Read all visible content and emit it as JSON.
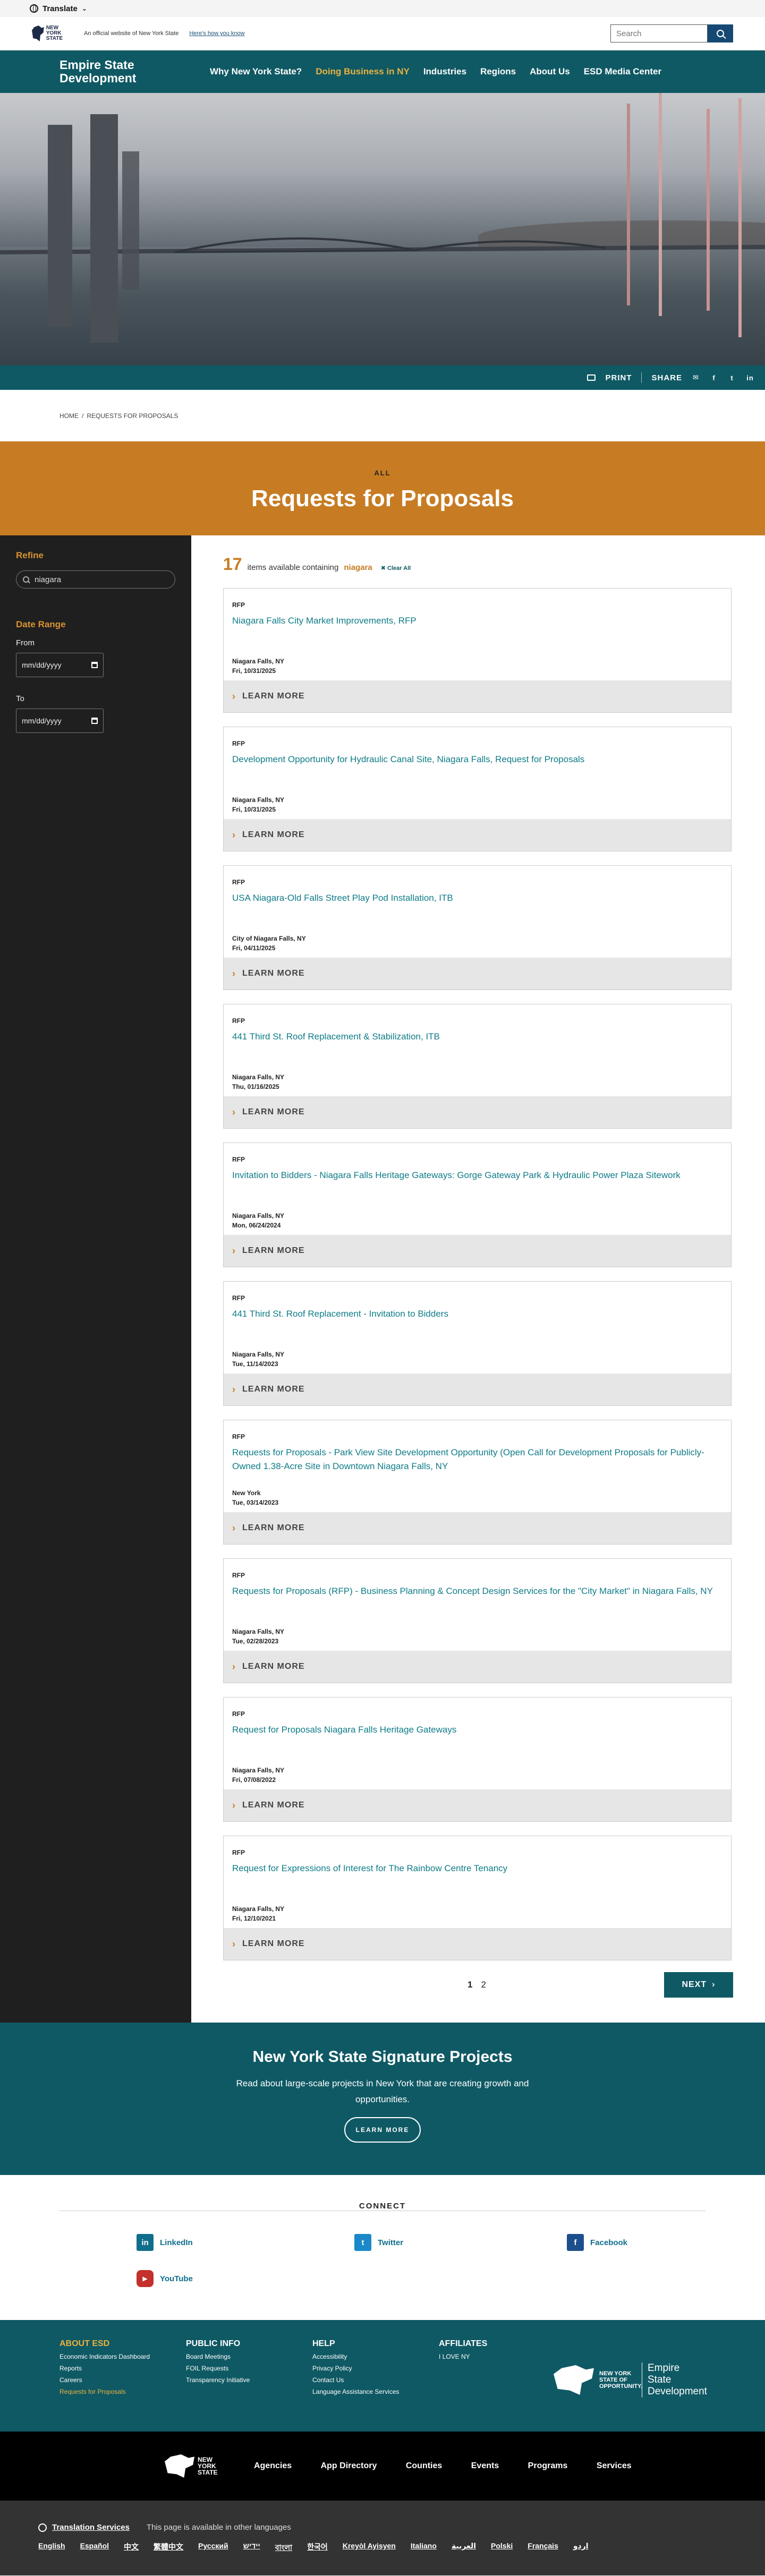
{
  "translate": {
    "label": "Translate"
  },
  "universal_header": {
    "logo_text": "NEW YORK STATE",
    "official": "An official website of New York State",
    "how_know": "Here's how you know",
    "search_placeholder": "Search"
  },
  "site_nav": {
    "brand": "Empire State Development",
    "links": [
      "Why New York State?",
      "Doing Business in NY",
      "Industries",
      "Regions",
      "About Us",
      "ESD Media Center"
    ],
    "active_index": 1
  },
  "utility": {
    "print": "PRINT",
    "share": "SHARE"
  },
  "breadcrumb": {
    "home": "HOME",
    "sep": "/",
    "current": "REQUESTS FOR PROPOSALS"
  },
  "band": {
    "kicker": "ALL",
    "title": "Requests for Proposals"
  },
  "sidebar": {
    "refine_heading": "Refine",
    "refine_value": "niagara",
    "date_heading": "Date Range",
    "from_label": "From",
    "to_label": "To",
    "date_placeholder": "mm/dd/yyyy"
  },
  "results": {
    "count": "17",
    "text": "items available containing",
    "term": "niagara",
    "clear": "✖ Clear All"
  },
  "cards": [
    {
      "tag": "RFP",
      "title": "Niagara Falls City Market Improvements, RFP",
      "location": "Niagara Falls, NY",
      "date": "Fri, 10/31/2025"
    },
    {
      "tag": "RFP",
      "title": "Development Opportunity for Hydraulic Canal Site, Niagara Falls, Request for Proposals",
      "location": "Niagara Falls, NY",
      "date": "Fri, 10/31/2025"
    },
    {
      "tag": "RFP",
      "title": "USA Niagara-Old Falls Street Play Pod Installation, ITB",
      "location": "City of Niagara Falls, NY",
      "date": "Fri, 04/11/2025"
    },
    {
      "tag": "RFP",
      "title": "441 Third St. Roof Replacement & Stabilization, ITB",
      "location": "Niagara Falls, NY",
      "date": "Thu, 01/16/2025"
    },
    {
      "tag": "RFP",
      "title": "Invitation to Bidders - Niagara Falls Heritage Gateways: Gorge Gateway Park & Hydraulic Power Plaza Sitework",
      "location": "Niagara Falls, NY",
      "date": "Mon, 06/24/2024"
    },
    {
      "tag": "RFP",
      "title": "441 Third St. Roof Replacement - Invitation to Bidders",
      "location": "Niagara Falls, NY",
      "date": "Tue, 11/14/2023"
    },
    {
      "tag": "RFP",
      "title": "Requests for Proposals - Park View Site Development Opportunity (Open Call for Development Proposals for Publicly-Owned 1.38-Acre Site in Downtown Niagara Falls, NY",
      "location": "New York",
      "date": "Tue, 03/14/2023"
    },
    {
      "tag": "RFP",
      "title": "Requests for Proposals (RFP) - Business Planning & Concept Design Services for the \"City Market\" in Niagara Falls, NY",
      "location": "Niagara Falls, NY",
      "date": "Tue, 02/28/2023"
    },
    {
      "tag": "RFP",
      "title": "Request for Proposals Niagara Falls Heritage Gateways",
      "location": "Niagara Falls, NY",
      "date": "Fri, 07/08/2022"
    },
    {
      "tag": "RFP",
      "title": "Request for Expressions of Interest for The Rainbow Centre Tenancy",
      "location": "Niagara Falls, NY",
      "date": "Fri, 12/10/2021"
    }
  ],
  "learn_more": "LEARN MORE",
  "pager": {
    "page1": "1",
    "page2": "2",
    "next": "NEXT"
  },
  "signature": {
    "title": "New York State Signature Projects",
    "text": "Read about large-scale projects in New York that are creating growth and opportunities.",
    "button": "LEARN MORE"
  },
  "connect": {
    "title": "CONNECT",
    "items": [
      {
        "name": "LinkedIn",
        "icon": "in",
        "color": "#0f6e8c"
      },
      {
        "name": "Twitter",
        "icon": "t",
        "color": "#1b88c9"
      },
      {
        "name": "Facebook",
        "icon": "f",
        "color": "#1d4f8c"
      },
      {
        "name": "YouTube",
        "icon": "▶",
        "color": "#c4302b"
      }
    ]
  },
  "footer": {
    "columns": [
      {
        "heading": "ABOUT ESD",
        "links": [
          "Economic Indicators Dashboard",
          "Reports",
          "Careers",
          "Requests for Proposals"
        ]
      },
      {
        "heading": "PUBLIC INFO",
        "links": [
          "Board Meetings",
          "FOIL Requests",
          "Transparency Initiative"
        ]
      },
      {
        "heading": "HELP",
        "links": [
          "Accessibility",
          "Privacy Policy",
          "Contact Us",
          "Language Assistance Services"
        ]
      },
      {
        "heading": "AFFILIATES",
        "links": [
          "I LOVE NY"
        ]
      }
    ],
    "logo_nys": "NEW YORK STATE OF OPPORTUNITY.",
    "logo_esd": "Empire State Development",
    "nys_logo": "NEW YORK STATE",
    "bottom_links": [
      "Agencies",
      "App Directory",
      "Counties",
      "Events",
      "Programs",
      "Services"
    ],
    "translation_services": "Translation Services",
    "available": "This page is available in other languages",
    "languages": [
      "English",
      "Español",
      "中文",
      "繁體中文",
      "Русский",
      "יידיש",
      "বাংলা",
      "한국어",
      "Kreyòl Ayisyen",
      "Italiano",
      "العربية",
      "Polski",
      "Français",
      "اردو"
    ]
  }
}
